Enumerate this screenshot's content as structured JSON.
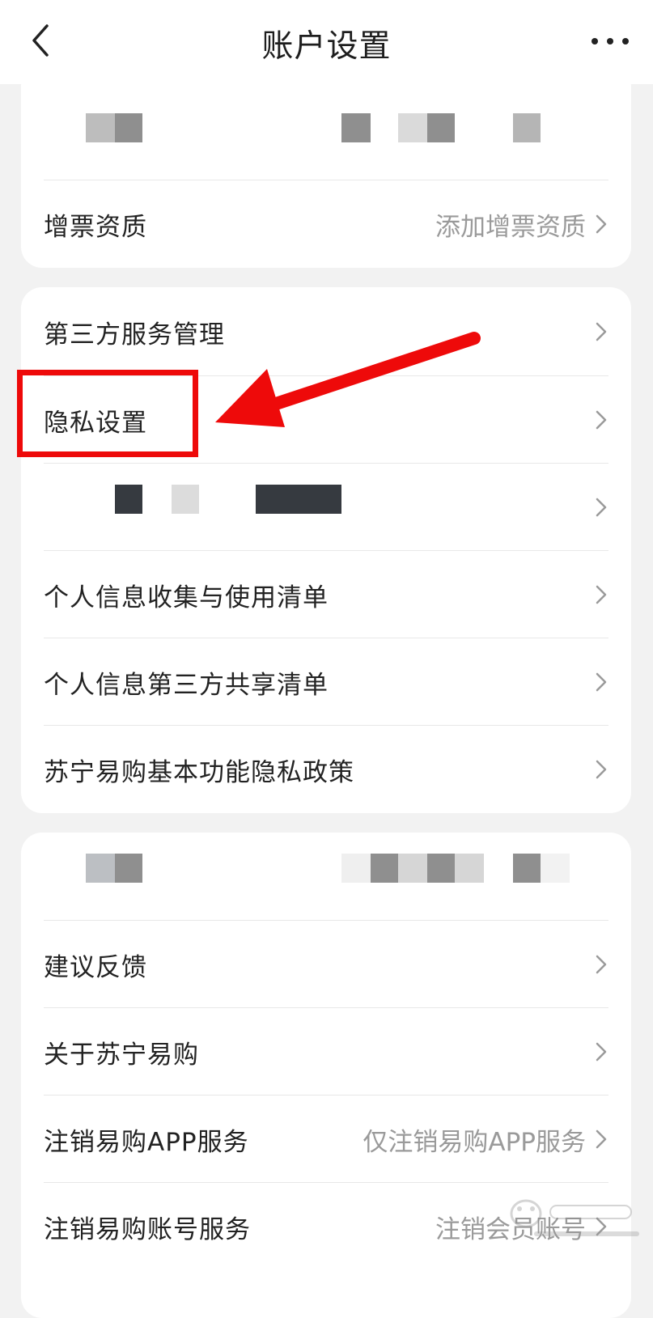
{
  "header": {
    "title": "账户设置"
  },
  "section1": {
    "invoice_label": "增票资质",
    "invoice_value": "添加增票资质"
  },
  "section2": {
    "items": [
      {
        "label": "第三方服务管理"
      },
      {
        "label": "隐私设置"
      },
      {
        "label": ""
      },
      {
        "label": "个人信息收集与使用清单"
      },
      {
        "label": "个人信息第三方共享清单"
      },
      {
        "label": "苏宁易购基本功能隐私政策"
      }
    ]
  },
  "section3": {
    "items": [
      {
        "label": "建议反馈",
        "value": ""
      },
      {
        "label": "关于苏宁易购",
        "value": ""
      },
      {
        "label": "注销易购APP服务",
        "value": "仅注销易购APP服务"
      },
      {
        "label": "注销易购账号服务",
        "value": "注销会员账号"
      }
    ]
  },
  "annotation": {
    "color": "#ee0a0a"
  },
  "icons": [
    "back-arrow-icon",
    "more-icon",
    "chevron-right-icon"
  ]
}
